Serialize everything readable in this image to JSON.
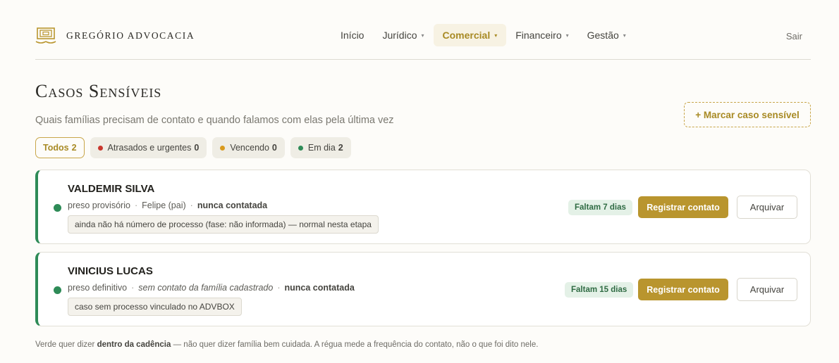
{
  "brand": {
    "name": "GREGÓRIO ADVOCACIA",
    "logo_icon": "scales-building-logo"
  },
  "nav": {
    "items": [
      {
        "label": "Início",
        "dropdown": false,
        "active": false
      },
      {
        "label": "Jurídico",
        "dropdown": true,
        "active": false
      },
      {
        "label": "Comercial",
        "dropdown": true,
        "active": true
      },
      {
        "label": "Financeiro",
        "dropdown": true,
        "active": false
      },
      {
        "label": "Gestão",
        "dropdown": true,
        "active": false
      }
    ],
    "logout": "Sair"
  },
  "page": {
    "title": "Casos Sensíveis",
    "subtitle": "Quais famílias precisam de contato e quando falamos com elas pela última vez",
    "mark_button": "+ Marcar caso sensível"
  },
  "filters": [
    {
      "label": "Todos",
      "count": "2",
      "active": true,
      "color": ""
    },
    {
      "label": "Atrasados e urgentes",
      "count": "0",
      "active": false,
      "color": "#c8372d"
    },
    {
      "label": "Vencendo",
      "count": "0",
      "active": false,
      "color": "#d99a1e"
    },
    {
      "label": "Em dia",
      "count": "2",
      "active": false,
      "color": "#2e8b57"
    }
  ],
  "cases": [
    {
      "name": "VALDEMIR SILVA",
      "status": "preso provisório",
      "contact": "Felipe (pai)",
      "contact_missing": false,
      "last_contact": "nunca contatada",
      "note": "ainda não há número de processo (fase: não informada) — normal nesta etapa",
      "deadline": "Faltam 7 dias",
      "status_color": "#2e8b57"
    },
    {
      "name": "VINICIUS LUCAS",
      "status": "preso definitivo",
      "contact": "sem contato da família cadastrado",
      "contact_missing": true,
      "last_contact": "nunca contatada",
      "note": "caso sem processo vinculado no ADVBOX",
      "deadline": "Faltam 15 dias",
      "status_color": "#2e8b57"
    }
  ],
  "actions": {
    "register": "Registrar contato",
    "archive": "Arquivar"
  },
  "footnote": {
    "prefix": "Verde quer dizer ",
    "bold": "dentro da cadência",
    "suffix": " — não quer dizer família bem cuidada. A régua mede a frequência do contato, não o que foi dito nele."
  }
}
